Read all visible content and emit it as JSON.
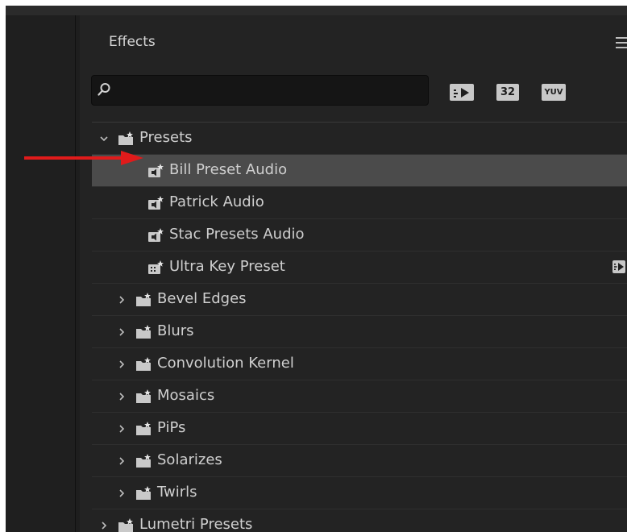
{
  "panel": {
    "title": "Effects"
  },
  "search": {
    "value": "",
    "placeholder": ""
  },
  "filters": {
    "accelerated_label": "",
    "bit32_label": "32",
    "yuv_label": "YUV"
  },
  "tree": [
    {
      "label": "Presets",
      "level": 0,
      "expanded": true,
      "type": "folder"
    },
    {
      "label": "Bill Preset Audio",
      "level": 1,
      "type": "audio-preset",
      "selected": true
    },
    {
      "label": "Patrick Audio",
      "level": 1,
      "type": "audio-preset"
    },
    {
      "label": "Stac Presets Audio",
      "level": 1,
      "type": "audio-preset"
    },
    {
      "label": "Ultra Key Preset",
      "level": 1,
      "type": "video-preset",
      "badge": "accelerated"
    },
    {
      "label": "Bevel Edges",
      "level": 1,
      "expanded": false,
      "type": "folder"
    },
    {
      "label": "Blurs",
      "level": 1,
      "expanded": false,
      "type": "folder"
    },
    {
      "label": "Convolution Kernel",
      "level": 1,
      "expanded": false,
      "type": "folder"
    },
    {
      "label": "Mosaics",
      "level": 1,
      "expanded": false,
      "type": "folder"
    },
    {
      "label": "PiPs",
      "level": 1,
      "expanded": false,
      "type": "folder"
    },
    {
      "label": "Solarizes",
      "level": 1,
      "expanded": false,
      "type": "folder"
    },
    {
      "label": "Twirls",
      "level": 1,
      "expanded": false,
      "type": "folder"
    },
    {
      "label": "Lumetri Presets",
      "level": 0,
      "expanded": false,
      "type": "folder"
    }
  ],
  "colors": {
    "panel_bg": "#232323",
    "selected_bg": "#4b4b4b",
    "text": "#cfcfcf",
    "annotation_arrow": "#e01b1b"
  }
}
